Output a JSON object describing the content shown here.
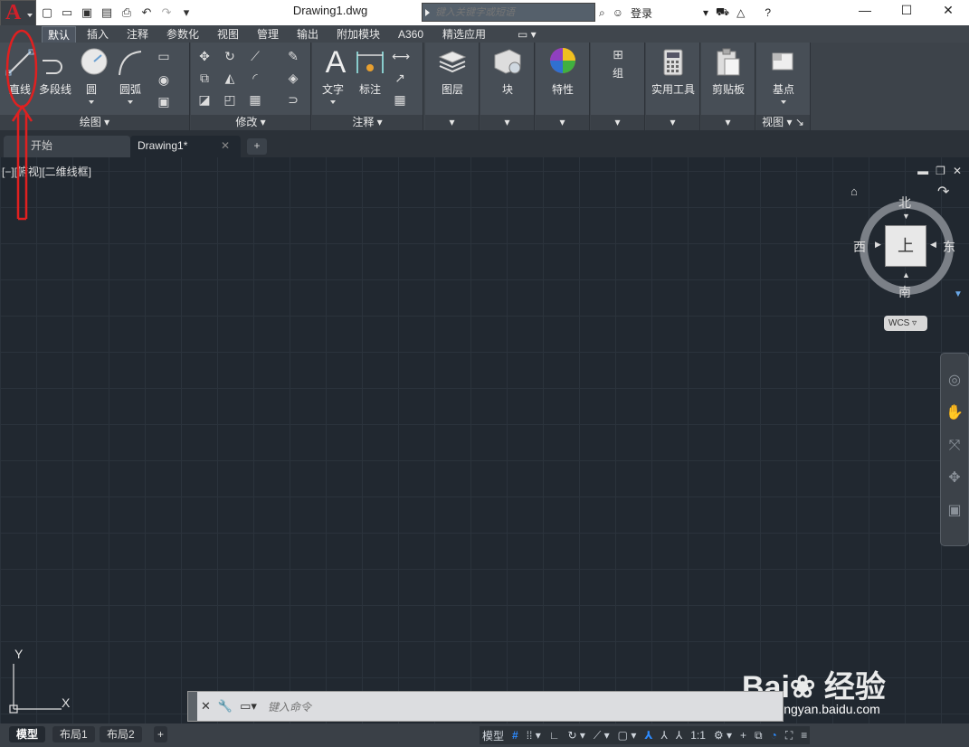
{
  "title_bar": {
    "document": "Drawing1.dwg",
    "search_placeholder": "键入关键字或短语",
    "login": "登录"
  },
  "ribbon_tabs": [
    "默认",
    "插入",
    "注释",
    "参数化",
    "视图",
    "管理",
    "输出",
    "附加模块",
    "A360",
    "精选应用"
  ],
  "active_tab": "默认",
  "draw_panel": {
    "title": "绘图",
    "line": "直线",
    "polyline": "多段线",
    "circle": "圆",
    "arc": "圆弧"
  },
  "modify_panel": {
    "title": "修改"
  },
  "annotation_panel": {
    "title": "注释",
    "text": "文字",
    "dimension": "标注"
  },
  "panels": {
    "layers": "图层",
    "block": "块",
    "properties": "特性",
    "groups": "组",
    "utilities": "实用工具",
    "clipboard": "剪贴板",
    "base": "基点",
    "view": "视图"
  },
  "file_tabs": {
    "start": "开始",
    "drawing": "Drawing1*"
  },
  "viewport": {
    "label": "[−][俯视][二维线框]"
  },
  "viewcube": {
    "north": "北",
    "south": "南",
    "east": "东",
    "west": "西",
    "face": "上",
    "wcs": "WCS"
  },
  "ucs": {
    "x": "X",
    "y": "Y"
  },
  "command_line": {
    "placeholder": "键入命令"
  },
  "status_bar": {
    "layouts": [
      "模型",
      "布局1",
      "布局2"
    ],
    "model_button": "模型",
    "scale": "1:1"
  },
  "watermark": {
    "brand": "Bai",
    "brand2": "经验",
    "url": "jingyan.baidu.com"
  },
  "accent_color": "#e02020"
}
